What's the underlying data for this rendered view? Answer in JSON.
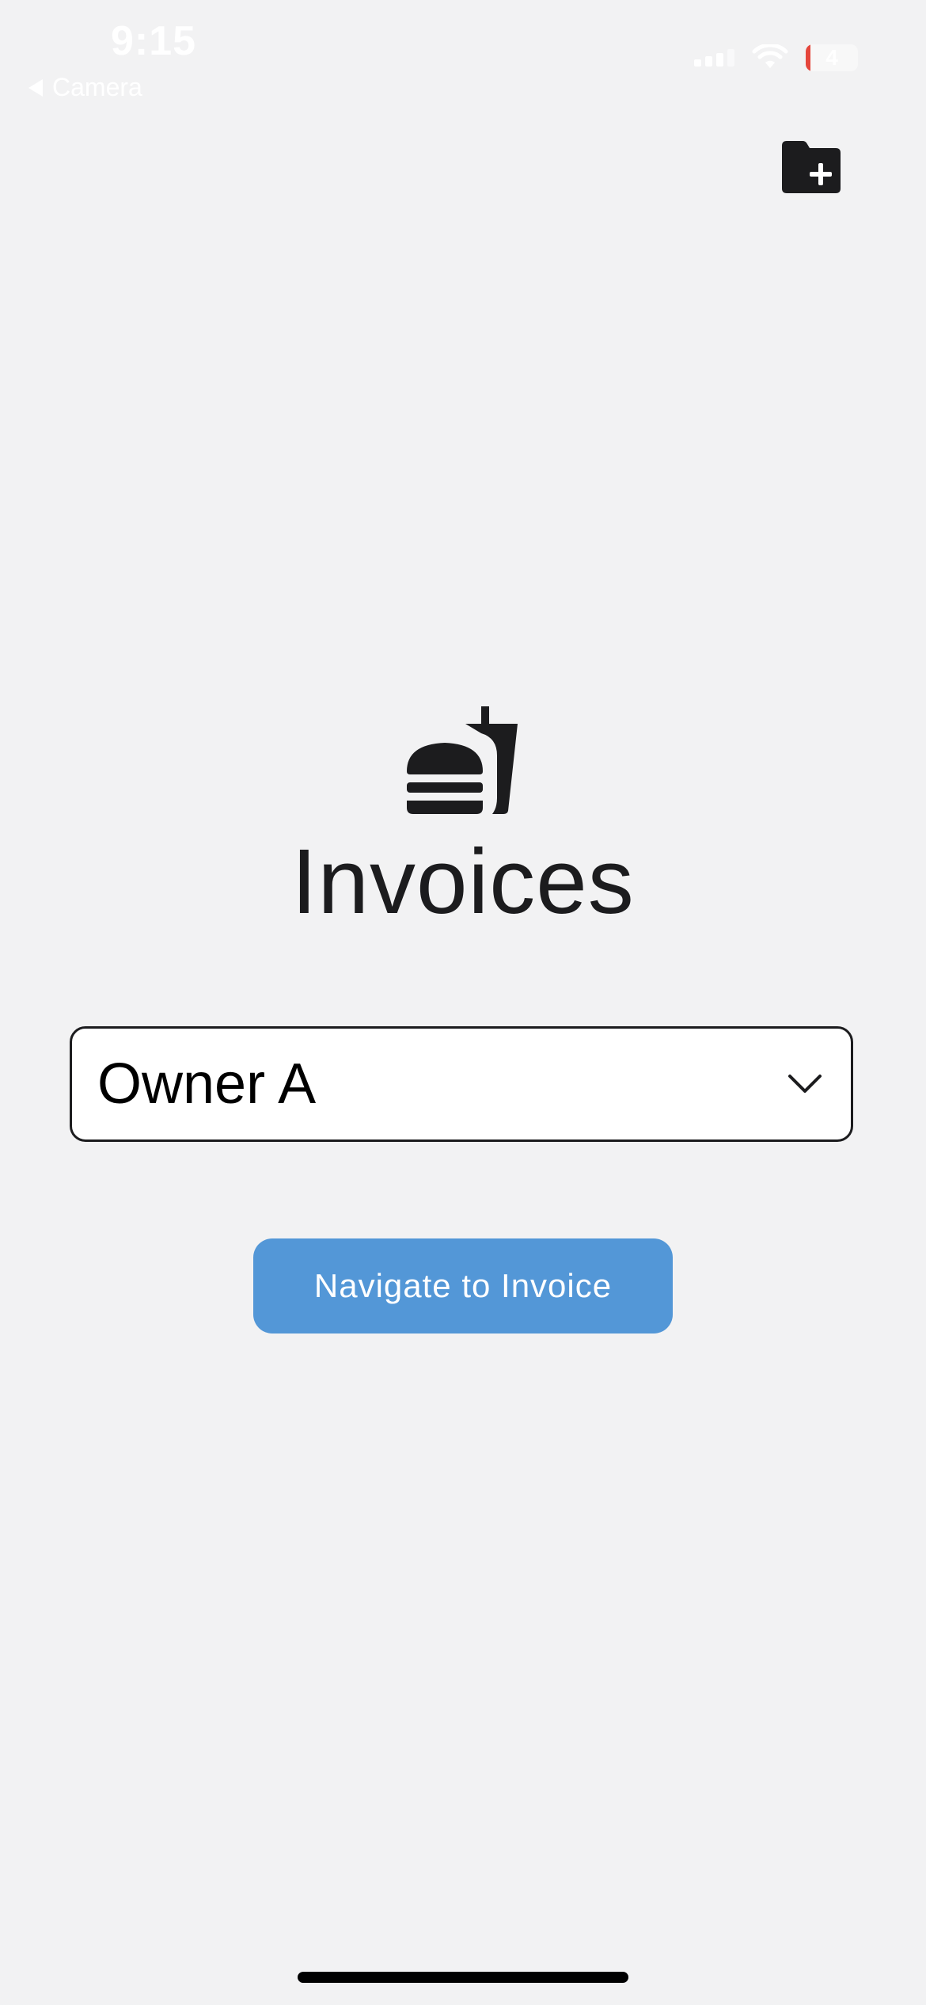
{
  "status_bar": {
    "time": "9:15",
    "back_label": "Camera",
    "battery": "4"
  },
  "toolbar": {
    "new_folder_icon": "folder-plus-icon"
  },
  "main": {
    "logo_icon": "burger-and-drink-icon",
    "title": "Invoices",
    "owner_select": {
      "selected": "Owner A"
    },
    "nav_button_label": "Navigate to Invoice"
  },
  "colors": {
    "background": "#f2f2f3",
    "accent": "#5397d7",
    "text": "#1c1c1e"
  }
}
